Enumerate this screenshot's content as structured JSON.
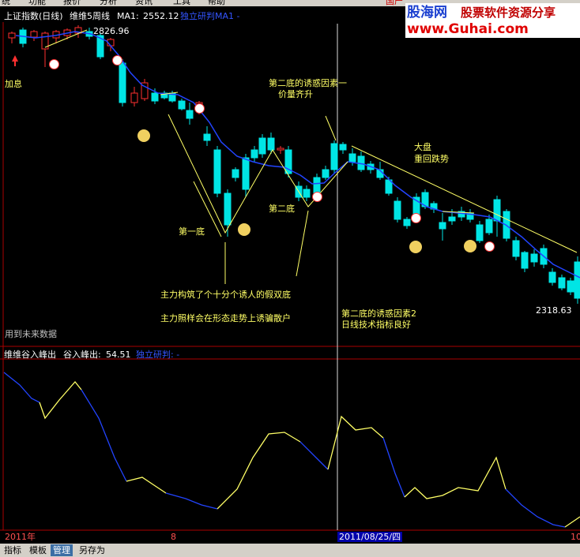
{
  "menu": [
    "统",
    "功能",
    "报价",
    "分析",
    "资讯",
    "工具",
    "帮助"
  ],
  "menu_right": "国产",
  "upper": {
    "title": "上证指数(日线)",
    "ind_name": "维维5周线",
    "ma_label": "MA1:",
    "ma_value": "2552.12",
    "extra": "独立研判MA1 -",
    "high_label": "2826.96",
    "low_label": "2318.63",
    "note_jiaxi": "加息",
    "future_data": "用到未来数据"
  },
  "annotations": {
    "second_bottom_lure1": "第二底的诱惑因素一",
    "vol_price": "价量齐升",
    "market": "大盘",
    "fall_again": "重回跌势",
    "second_bottom": "第二底",
    "first_bottom": "第一底",
    "fake_double": "主力构筑了个十分个诱人的假双底",
    "trap": "主力照样会在形态走势上诱骗散户",
    "second_bottom_lure2": "第二底的诱惑因素2",
    "daily_good": "日线技术指标良好"
  },
  "lower": {
    "title": "维维谷入峰出",
    "label": "谷入峰出:",
    "value": "54.51",
    "extra": "独立研判: -"
  },
  "date_axis": {
    "left": "2011年",
    "mid": "8",
    "cursor": "2011/08/25/四",
    "right": "10"
  },
  "tabs": [
    "指标",
    "模板",
    "管理",
    "另存为"
  ],
  "logo": {
    "brand": "股海网",
    "slogan": "股票软件资源分享",
    "url": "www.Guhai.com"
  },
  "colors": {
    "up": "#ff3030",
    "down": "#00e5e5",
    "ma": "#2244ff",
    "text": "#ffff66"
  },
  "chart_data": {
    "type": "candlestick",
    "cursor_date": "2011/08/25",
    "high": 2826.96,
    "low": 2318.63,
    "ma1": 2552.12,
    "oscillator_last": 54.51
  }
}
